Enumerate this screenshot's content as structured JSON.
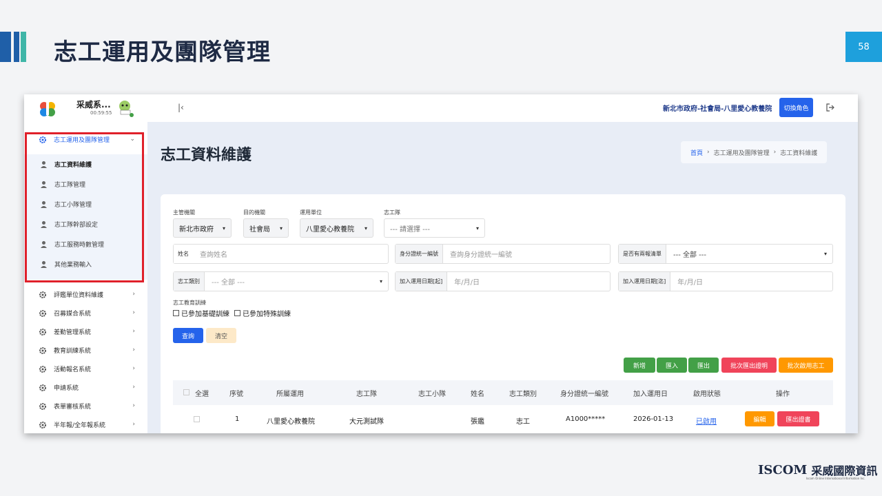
{
  "slide": {
    "title": "志工運用及團隊管理",
    "page_number": "58",
    "logo_en": "ISCOM",
    "logo_zh": "采威國際資訊",
    "logo_sub": "Iscom Online International Information Inc."
  },
  "app": {
    "name": "采威系...",
    "time": "00:59:55",
    "org": "新北市政府-社會局-八里愛心教養院",
    "switch_role": "切換角色"
  },
  "sidebar": {
    "active_group": "志工運用及團隊管理",
    "sub_items": [
      "志工資料維護",
      "志工隊管理",
      "志工小隊管理",
      "志工隊幹部設定",
      "志工服務時數管理",
      "其他業務輸入"
    ],
    "groups": [
      "評鑑單位資料維護",
      "召募媒合系統",
      "差勤管理系統",
      "教育訓練系統",
      "活動報名系統",
      "申請系統",
      "表單審核系統",
      "半年報/全年報系統"
    ]
  },
  "page": {
    "heading": "志工資料維護",
    "breadcrumb": [
      "首頁",
      "志工運用及團隊管理",
      "志工資料維護"
    ],
    "crumb_sep": "›"
  },
  "filters": {
    "agency_label": "主管機關",
    "agency_value": "新北市政府",
    "dept_label": "目的機關",
    "dept_value": "社會局",
    "unit_label": "運用單位",
    "unit_value": "八里愛心教養院",
    "team_label": "志工隊",
    "team_value": "--- 請選擇 ---",
    "name_label": "姓名",
    "name_placeholder": "查詢姓名",
    "id_label": "身分證統一編號",
    "id_placeholder": "查詢身分證統一編號",
    "list_label": "是否有兩報清單",
    "list_value": "--- 全部 ---",
    "type_label": "志工類別",
    "type_value": "--- 全部 ---",
    "join_start_label": "加入運用日期[起]",
    "join_start_placeholder": "年/月/日",
    "join_end_label": "加入運用日期[迄]",
    "join_end_placeholder": "年/月/日",
    "training_label": "志工教育訓練",
    "training_options": [
      "已參加基礎訓練",
      "已參加特殊訓練"
    ],
    "search_btn": "查詢",
    "clear_btn": "清空"
  },
  "actions": [
    "新增",
    "匯入",
    "匯出",
    "批次匯出證明",
    "批次啟用志工"
  ],
  "table": {
    "headers": [
      "全選",
      "序號",
      "所屬運用",
      "志工隊",
      "志工小隊",
      "姓名",
      "志工類別",
      "身分證統一編號",
      "加入運用日",
      "啟用狀態",
      "操作"
    ],
    "rows": [
      {
        "seq": "1",
        "unit": "八里愛心教養院",
        "team": "大元測試隊",
        "subteam": "",
        "name": "張鑑",
        "type": "志工",
        "id": "A1000*****",
        "join_date": "2026-01-13",
        "status": "已啟用",
        "edit": "編輯",
        "export": "匯出證書"
      }
    ]
  },
  "colors": {
    "primary": "#2563eb",
    "green": "#43a047",
    "red": "#f0445a",
    "orange": "#ff9800",
    "highlight": "#e0202a"
  }
}
